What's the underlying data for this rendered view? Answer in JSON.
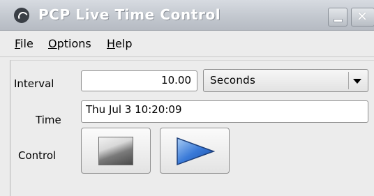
{
  "window": {
    "title": "PCP Live Time Control"
  },
  "menu": {
    "file": {
      "mnemonic": "F",
      "rest": "ile"
    },
    "options": {
      "mnemonic": "O",
      "rest": "ptions"
    },
    "help": {
      "mnemonic": "H",
      "rest": "elp"
    }
  },
  "form": {
    "interval_label": "Interval",
    "interval_value": "10.00",
    "interval_unit": "Seconds",
    "time_label": "Time",
    "time_value": "Thu Jul 3 10:20:09",
    "control_label": "Control"
  },
  "icons": {
    "app": "pcp-app-icon",
    "minimize": "minimize-icon",
    "close": "close-icon",
    "dropdown": "chevron-down-icon",
    "stop": "stop-icon",
    "play": "play-icon"
  },
  "colors": {
    "title_text": "#ffffff",
    "titlebar": "#c3c8cf",
    "play_blue": "#2f6fd0",
    "background": "#ececec"
  }
}
